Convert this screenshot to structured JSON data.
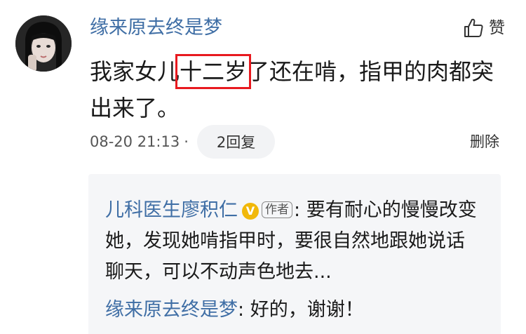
{
  "comment": {
    "username": "缘来原去终是梦",
    "text_before": "我家女儿",
    "text_highlight": "十二岁",
    "text_after": "了还在啃，指甲的肉都突出来了。",
    "timestamp": "08-20 21:13",
    "separator": "·",
    "reply_button_label": "2回复",
    "delete_label": "删除",
    "like_label": "赞",
    "highlight_color": "#e8191f",
    "username_color": "#3f6ea5"
  },
  "replies": [
    {
      "author": "儿科医生廖积仁",
      "verified_badge": "V",
      "author_tag": "作者",
      "separator": ":",
      "text": " 要有耐心的慢慢改变她，发现她啃指甲时，要很自然地跟她说话聊天，可以不动声色地去..."
    },
    {
      "author": "缘来原去终是梦",
      "separator": ":",
      "text": " 好的，谢谢！"
    }
  ],
  "icons": {
    "avatar": "user-avatar-photo",
    "like": "thumbs-up-icon",
    "verified": "verified-v-icon"
  }
}
